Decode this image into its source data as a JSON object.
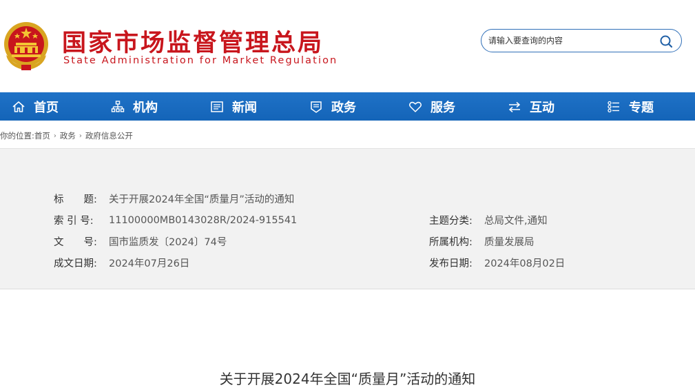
{
  "header": {
    "site_title": "国家市场监督管理总局",
    "site_subtitle": "State Administration for Market Regulation",
    "emblem_icon": "national-emblem-icon",
    "search": {
      "placeholder": "请输入要查询的内容",
      "value": "",
      "button_icon": "search-icon"
    }
  },
  "colors": {
    "brand_red": "#c8161d",
    "nav_blue": "#1464b8",
    "panel_gray": "#f2f2f2"
  },
  "nav": {
    "items": [
      {
        "label": "首页",
        "icon": "home-icon"
      },
      {
        "label": "机构",
        "icon": "org-chart-icon"
      },
      {
        "label": "新闻",
        "icon": "news-icon"
      },
      {
        "label": "政务",
        "icon": "badge-icon"
      },
      {
        "label": "服务",
        "icon": "heart-icon"
      },
      {
        "label": "互动",
        "icon": "exchange-icon"
      },
      {
        "label": "专题",
        "icon": "topic-list-icon"
      }
    ]
  },
  "breadcrumb": {
    "prefix": "你的位置:",
    "items": [
      "首页",
      "政务",
      "政府信息公开"
    ],
    "separator": "›"
  },
  "info": {
    "title_label": "标　　题:",
    "title_value": "关于开展2024年全国“质量月”活动的通知",
    "index_label": "索 引 号:",
    "index_value": "11100000MB0143028R/2024-915541",
    "docno_label": "文　　号:",
    "docno_value": "国市监质发〔2024〕74号",
    "created_label": "成文日期:",
    "created_value": "2024年07月26日",
    "category_label": "主题分类:",
    "category_value": "总局文件,通知",
    "org_label": "所属机构:",
    "org_value": "质量发展局",
    "published_label": "发布日期:",
    "published_value": "2024年08月02日"
  },
  "article": {
    "title": "关于开展2024年全国“质量月”活动的通知"
  }
}
